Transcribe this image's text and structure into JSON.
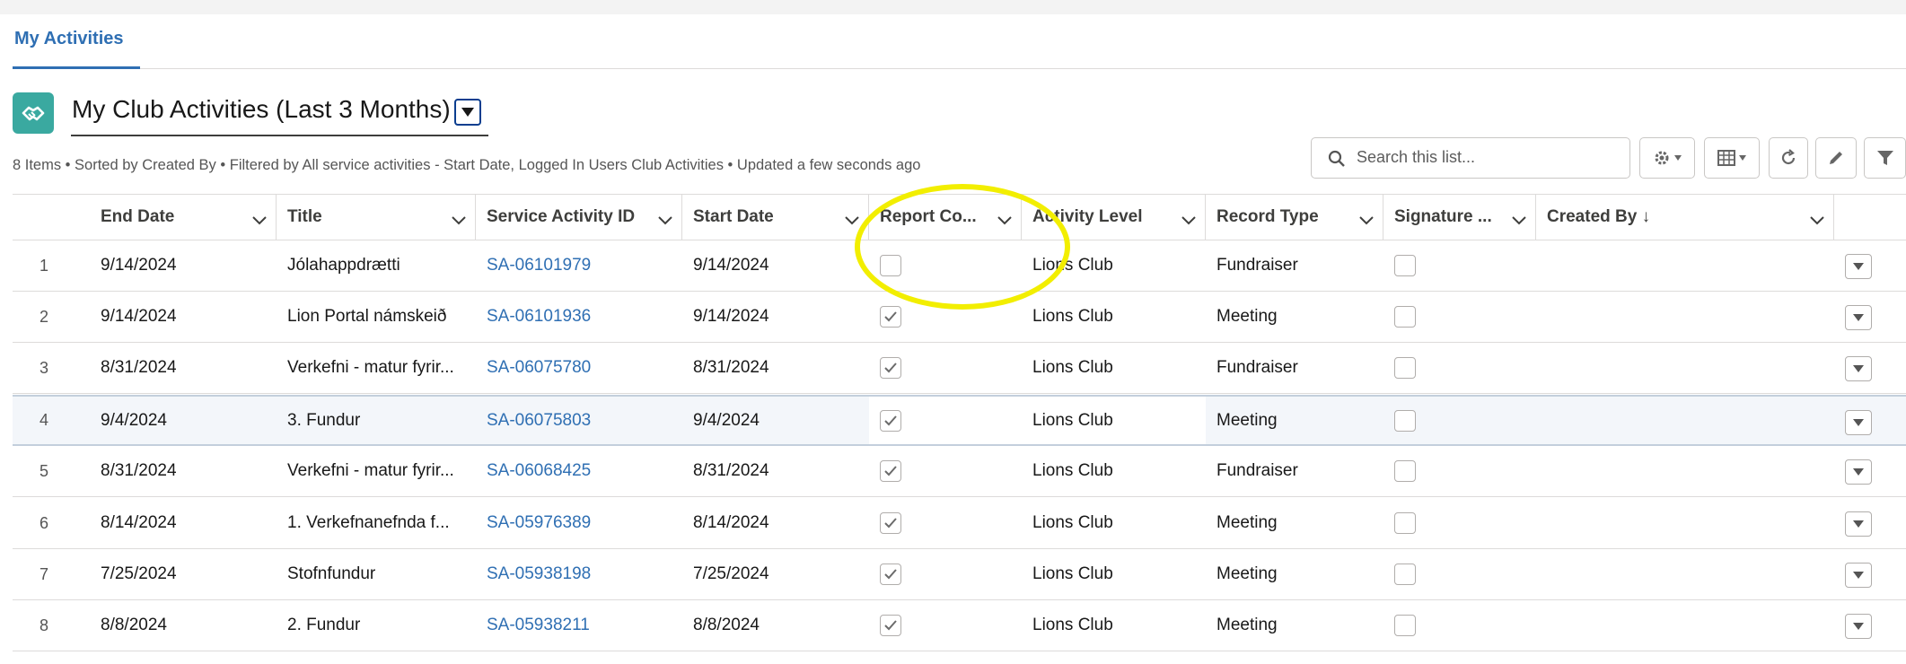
{
  "tabs": [
    {
      "label": "My Activities"
    }
  ],
  "header": {
    "title": "My Club Activities (Last 3 Months)",
    "meta": "8 Items • Sorted by Created By • Filtered by All service activities - Start Date, Logged In Users Club Activities • Updated a few seconds ago"
  },
  "search": {
    "placeholder": "Search this list..."
  },
  "toolbar": {
    "buttons": [
      "settings-gear-icon",
      "table-view-icon",
      "refresh-icon",
      "edit-pencil-icon",
      "filter-icon"
    ]
  },
  "columns": [
    {
      "label": "End Date"
    },
    {
      "label": "Title"
    },
    {
      "label": "Service Activity ID"
    },
    {
      "label": "Start Date"
    },
    {
      "label": "Report Co..."
    },
    {
      "label": "Activity Level"
    },
    {
      "label": "Record Type"
    },
    {
      "label": "Signature ..."
    },
    {
      "label": "Created By ↓"
    }
  ],
  "rows": [
    {
      "num": "1",
      "end_date": "9/14/2024",
      "title": "Jólahappdrætti",
      "id": "SA-06101979",
      "start_date": "9/14/2024",
      "report_completed": false,
      "activity_level": "Lions Club",
      "record_type": "Fundraiser",
      "signature": false,
      "created_by": ""
    },
    {
      "num": "2",
      "end_date": "9/14/2024",
      "title": "Lion Portal námskeið",
      "id": "SA-06101936",
      "start_date": "9/14/2024",
      "report_completed": true,
      "activity_level": "Lions Club",
      "record_type": "Meeting",
      "signature": false,
      "created_by": ""
    },
    {
      "num": "3",
      "end_date": "8/31/2024",
      "title": "Verkefni - matur fyrir...",
      "id": "SA-06075780",
      "start_date": "8/31/2024",
      "report_completed": true,
      "activity_level": "Lions Club",
      "record_type": "Fundraiser",
      "signature": false,
      "created_by": ""
    },
    {
      "num": "4",
      "end_date": "9/4/2024",
      "title": "3. Fundur",
      "id": "SA-06075803",
      "start_date": "9/4/2024",
      "report_completed": true,
      "activity_level": "Lions Club",
      "record_type": "Meeting",
      "signature": false,
      "created_by": ""
    },
    {
      "num": "5",
      "end_date": "8/31/2024",
      "title": "Verkefni - matur fyrir...",
      "id": "SA-06068425",
      "start_date": "8/31/2024",
      "report_completed": true,
      "activity_level": "Lions Club",
      "record_type": "Fundraiser",
      "signature": false,
      "created_by": ""
    },
    {
      "num": "6",
      "end_date": "8/14/2024",
      "title": "1. Verkefnanefnda f...",
      "id": "SA-05976389",
      "start_date": "8/14/2024",
      "report_completed": true,
      "activity_level": "Lions Club",
      "record_type": "Meeting",
      "signature": false,
      "created_by": ""
    },
    {
      "num": "7",
      "end_date": "7/25/2024",
      "title": "Stofnfundur",
      "id": "SA-05938198",
      "start_date": "7/25/2024",
      "report_completed": true,
      "activity_level": "Lions Club",
      "record_type": "Meeting",
      "signature": false,
      "created_by": ""
    },
    {
      "num": "8",
      "end_date": "8/8/2024",
      "title": "2. Fundur",
      "id": "SA-05938211",
      "start_date": "8/8/2024",
      "report_completed": true,
      "activity_level": "Lions Club",
      "record_type": "Meeting",
      "signature": false,
      "created_by": ""
    }
  ],
  "colors": {
    "accent": "#2f6fb3",
    "icon_bg": "#3aa9a0",
    "annotation": "#f2ee00"
  }
}
